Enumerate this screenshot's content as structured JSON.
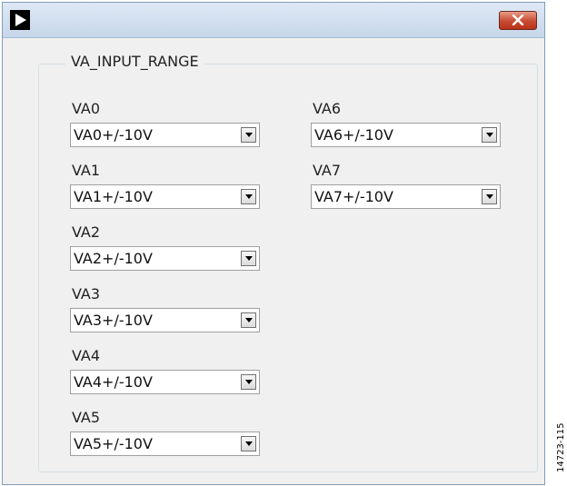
{
  "window": {
    "close_icon": "close-x-icon",
    "app_icon": "play-arrow-icon"
  },
  "group": {
    "title": "VA_INPUT_RANGE"
  },
  "fields": [
    {
      "label": "VA0",
      "value": "VA0+/-10V"
    },
    {
      "label": "VA1",
      "value": "VA1+/-10V"
    },
    {
      "label": "VA2",
      "value": "VA2+/-10V"
    },
    {
      "label": "VA3",
      "value": "VA3+/-10V"
    },
    {
      "label": "VA4",
      "value": "VA4+/-10V"
    },
    {
      "label": "VA5",
      "value": "VA5+/-10V"
    },
    {
      "label": "VA6",
      "value": "VA6+/-10V"
    },
    {
      "label": "VA7",
      "value": "VA7+/-10V"
    }
  ],
  "figure_id": "14723-115",
  "colors": {
    "close_button": "#c84a32",
    "titlebar": "#c6d6ea"
  }
}
